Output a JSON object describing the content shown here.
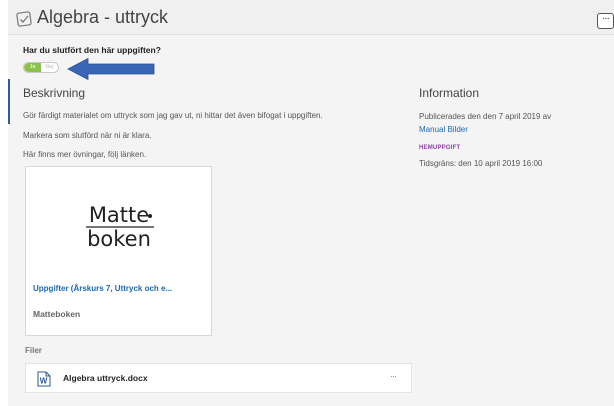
{
  "header": {
    "title": "Algebra - uttryck",
    "more_label": "···"
  },
  "completion": {
    "question": "Har du slutfört den här uppgiften?",
    "yes_label": "Ja",
    "no_label": "Nej"
  },
  "description": {
    "heading": "Beskrivning",
    "lines": [
      "Gör färdigt materialet om uttryck som jag gav ut, ni hittar det även bifogat i uppgiften.",
      "Markera som slutförd när ni är klara.",
      "Här finns mer övningar, följ länken."
    ]
  },
  "resource_card": {
    "logo_line1": "Matte",
    "logo_line2": "boken",
    "link_title": "Uppgifter (Årskurs 7, Uttryck och e...",
    "source": "Matteboken"
  },
  "files": {
    "label": "Filer",
    "items": [
      {
        "name": "Algebra uttryck.docx",
        "icon": "word-doc-icon",
        "more": "···"
      }
    ]
  },
  "info": {
    "heading": "Information",
    "published": "Publicerades den den 7 april 2019 av",
    "author": "Manual Bilder",
    "type_badge": "HEMUPPGIFT",
    "deadline": "Tidsgräns: den 10 april 2019 16:00"
  },
  "colors": {
    "toggle_on": "#8bc34a",
    "arrow": "#3a67b5",
    "link": "#1b68b8",
    "badge": "#8e44ad"
  }
}
